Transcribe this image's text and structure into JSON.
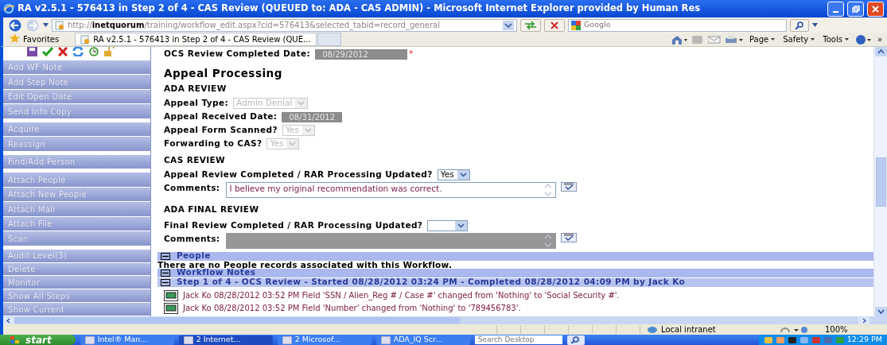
{
  "window": {
    "title": "RA v2.5.1 - 576413 in Step 2 of 4 - CAS Review (QUEUED to: ADA - CAS ADMIN) - Microsoft Internet Explorer provided by Human Res"
  },
  "address_bar": {
    "url": "http://**inetquorum**/training/workflow_edit.aspx?cid=576413&selected_tabid=record_general",
    "search_placeholder": "Google"
  },
  "favorites_bar": {
    "favorites": "Favorites",
    "tabs": [
      {
        "label": "RA v2.5.1 - 576413 in Step 2 of 4 - CAS Review (QUE...",
        "selected": true
      }
    ],
    "commands": [
      "Page",
      "Safety",
      "Tools"
    ],
    "more": "»"
  },
  "sidebar": {
    "groups": [
      [
        "Add WF Note",
        "Add Step Note",
        "Edit Open Date",
        "Send Info Copy"
      ],
      [
        "Acquire",
        "Reassign"
      ],
      [
        "Find/Add Person"
      ],
      [
        "Attach People",
        "Attach New People",
        "Attach Mail",
        "Attach File",
        "Scan"
      ],
      [
        "Audit Level(3)",
        "Delete",
        "Monitor",
        "Show All Steps",
        "Show Current"
      ]
    ]
  },
  "form": {
    "top_field": {
      "label": "OCS Review Completed Date:",
      "kind": "date",
      "value": "08/29/2012",
      "disabled": true,
      "required_mark": "*"
    },
    "heading": "Appeal Processing",
    "sections": [
      {
        "title": "ADA REVIEW",
        "fields": [
          {
            "label": "Appeal Type:",
            "kind": "select",
            "value": "Admin Denial",
            "disabled": true
          },
          {
            "label": "Appeal Received Date:",
            "kind": "date",
            "value": "08/31/2012",
            "disabled": true
          },
          {
            "label": "Appeal Form Scanned?",
            "kind": "select",
            "value": "Yes",
            "disabled": true
          },
          {
            "label": "Forwarding to CAS?",
            "kind": "select",
            "value": "Yes",
            "disabled": true
          }
        ]
      },
      {
        "title": "CAS REVIEW",
        "fields": [
          {
            "label": "Appeal Review Completed / RAR Processing Updated?",
            "kind": "select",
            "value": "Yes",
            "disabled": false
          },
          {
            "label": "Comments:",
            "kind": "textarea",
            "value": "I believe my original recommendation was correct.",
            "disabled": false
          }
        ]
      },
      {
        "title": "ADA FINAL REVIEW",
        "fields": [
          {
            "label": "Final Review Completed / RAR Processing Updated?",
            "kind": "select",
            "disabled": false
          },
          {
            "label": "Comments:",
            "kind": "textarea",
            "disabled": true
          }
        ]
      }
    ]
  },
  "panels": [
    {
      "kind": "section",
      "title": "People",
      "expanded": true
    },
    {
      "kind": "text",
      "text": "There are no People records associated with this Workflow."
    },
    {
      "kind": "section",
      "title": "Workflow Notes",
      "expanded": true
    },
    {
      "kind": "step",
      "title": "Step 1 of 4 - OCS Review - Started 08/28/2012 03:24 PM - Completed 08/28/2012 04:09 PM by Jack Ko",
      "expanded": true
    },
    {
      "kind": "note",
      "text": "Jack Ko 08/28/2012 03:52 PM Field 'SSN / Alien_Reg # / Case #' changed from 'Nothing' to 'Social Security #'."
    },
    {
      "kind": "note",
      "text": "Jack Ko 08/28/2012 03:52 PM Field 'Number' changed from 'Nothing' to '789456783'."
    }
  ],
  "status_bar": {
    "zone": "Local intranet",
    "zoom": "100%"
  },
  "taskbar": {
    "start": "start",
    "tasks": [
      {
        "label": "Intel® Man...",
        "selected": false
      },
      {
        "label": "2 Internet...",
        "selected": true
      },
      {
        "label": "2 Microsof...",
        "selected": false
      },
      {
        "label": "ADA_IQ Scr...",
        "selected": false
      }
    ],
    "search_placeholder": "Search Desktop",
    "clock": "12:29 PM"
  }
}
